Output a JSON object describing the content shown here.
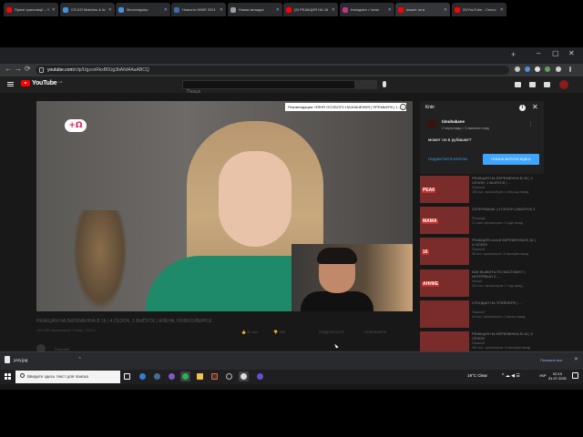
{
  "browser": {
    "tabs": [
      {
        "label": "Прямі трансляції – Yo",
        "fav_color": "#ff0000",
        "active": false
      },
      {
        "label": "CS:GO Matches & liv",
        "fav_color": "#4a90d9",
        "active": false
      },
      {
        "label": "Мессенджер",
        "fav_color": "#4a90d9",
        "active": false
      },
      {
        "label": "Новости WWE 2021",
        "fav_color": "#3a6ea5",
        "active": false
      },
      {
        "label": "Новая вкладка",
        "fav_color": "#9aa0a6",
        "active": false
      },
      {
        "label": "(9) РЕАКЦИЯ НА 16 І",
        "fav_color": "#ff0000",
        "active": false
      },
      {
        "label": "Instagram • Чаты",
        "fav_color": "#c13584",
        "active": false
      },
      {
        "label": "может он в",
        "fav_color": "#ff0000",
        "active": true
      },
      {
        "label": "20/YouTube - Сенчо",
        "fav_color": "#ff0000",
        "active": false
      }
    ],
    "new_tab": "+",
    "window_controls": {
      "minimize": "–",
      "maximize": "▢",
      "close": "✕"
    },
    "back": "←",
    "forward": "→",
    "reload": "⟳",
    "url_host": "youtube.com",
    "url_path": "/clip/UgzoxRkxB0Ug3bA6d4AaABCQ"
  },
  "youtube": {
    "logo_text": "YouTube",
    "logo_sup": "UA",
    "search_placeholder": "Пошук",
    "player": {
      "recommendation": "Рекомендация: НЯНЯ ОСОБОГО НАЗНАЧЕНИЯ | ПРЕМЬЕРА | 1...",
      "info_icon": "i",
      "logo": "+Ω"
    },
    "video": {
      "title": "РЕАКЦИЯ НА БЕРЕМЕННА В 16 | 4 СЕЗОН, 1 ВЫПУСК | АЛЕНА, НОВОСИБИРСК",
      "meta": "156 938 просмотров • 9 мар. 2021 г.",
      "likes": "11 тыс.",
      "dislikes": "799",
      "share": "ПОДЕЛИТЬСЯ",
      "save": "СОХРАНИТЬ",
      "channel": "Пошлый"
    },
    "clip": {
      "title": "Кліп",
      "info": "i",
      "close": "✕",
      "user": "timuhakane",
      "meta": "2 перегляди • 3 хвилини тому",
      "more": "⋮",
      "text": "может он в рубашке?",
      "share_label": "ПОДІЛИТИСЯ КЛІПОМ",
      "full_label": "ПОВНА ВЕРСІЯ ВІДЕО"
    },
    "recommendations": [
      {
        "title": "РЕАКЦИЯ НА БЕРЕМЕННА В 16 | 4 СЕЗОН, 1 ВЫПУСК | ...",
        "channel": "Пошлый",
        "views": "156 тыс. просмотров • 4 месяца назад",
        "tag": "РЕАК"
      },
      {
        "title": "СУПЕРМАМА | 4 СЕЗОН | ВЫПУСК 2",
        "channel": "Пятница!",
        "views": "2,4 млн просмотров • 2 года назад",
        "tag": "МАМА"
      },
      {
        "title": "РЕАКЦИЯ гостей БЕРЕМЕННА В 16 | 4 СЕЗОН",
        "channel": "Пошлый",
        "views": "98 тыс. просмотров • 5 месяцев назад",
        "tag": "16"
      },
      {
        "title": "КАК ВЫЖИТЬ ПО БАСТИАНУ | ИНТЕРВЬЮ С ...",
        "channel": "Лёгкий",
        "views": "312 тыс. просмотров • 1 год назад",
        "tag": "АНИКЕ"
      },
      {
        "title": "СТЕНДАП НА ТРЕЙНЕРЕ | ...",
        "channel": "Пошлый",
        "views": "44 тыс. просмотров • 1 месяц назад",
        "tag": ""
      },
      {
        "title": "РЕАКЦИЯ НА БЕРЕМЕННА В 16 | 3 СЕЗОН",
        "channel": "Пошлый",
        "views": "201 тыс. просмотров • 6 месяцев назад",
        "tag": ""
      }
    ]
  },
  "downloads": {
    "file": "yary.jpg",
    "arrow": "^",
    "show_all": "Показать все",
    "close": "✕"
  },
  "taskbar": {
    "search_text": "Введите здесь текст для поиска",
    "weather": "19°C  Clear",
    "tray_icons": "^ ☁ ◀ ☰",
    "lang": "УКР",
    "time": "02:10",
    "date": "31.07.2021"
  }
}
